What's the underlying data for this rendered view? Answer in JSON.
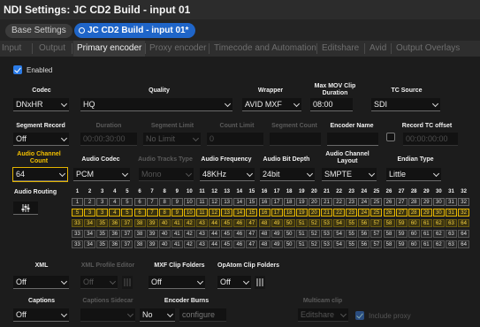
{
  "window": {
    "title": "NDI Settings: JC CD2 Build - input 01"
  },
  "settings_bar": {
    "base_label": "Base Settings",
    "active_label": "JC CD2 Build - input 01*"
  },
  "tabs": [
    "Input",
    "Output",
    "Primary encoder",
    "Proxy encoder",
    "Timecode and Automation",
    "Editshare",
    "Avid",
    "Output Overlays"
  ],
  "active_tab": "Primary encoder",
  "enabled": {
    "label": "Enabled",
    "checked": true
  },
  "row1": {
    "codec": {
      "label": "Codec",
      "value": "DNxHR"
    },
    "quality": {
      "label": "Quality",
      "value": "HQ"
    },
    "wrapper": {
      "label": "Wrapper",
      "value": "AVID MXF"
    },
    "max_mov": {
      "label_line1": "Max MOV Clip",
      "label_line2": "Duration",
      "value": "08:00"
    },
    "tc_source": {
      "label": "TC Source",
      "value": "SDI"
    }
  },
  "row2": {
    "segment_record": {
      "label": "Segment Record",
      "value": "Off"
    },
    "duration": {
      "label": "Duration",
      "value": "00:00:30:00"
    },
    "segment_limit": {
      "label": "Segment Limit",
      "value": "No Limit"
    },
    "count_limit": {
      "label": "Count Limit",
      "value": "0"
    },
    "segment_count": {
      "label": "Segment Count",
      "value": ""
    },
    "encoder_name": {
      "label": "Encoder Name",
      "value": ""
    },
    "record_tc_offset": {
      "label": "Record TC offset",
      "value": "00:00:00:00",
      "checked": false
    }
  },
  "row3": {
    "audio_channel_count": {
      "label_line1": "Audio Channel",
      "label_line2": "Count",
      "value": "64"
    },
    "audio_codec": {
      "label": "Audio Codec",
      "value": "PCM"
    },
    "audio_tracks_type": {
      "label": "Audio Tracks Type",
      "value": "Mono"
    },
    "audio_frequency": {
      "label": "Audio Frequency",
      "value": "48KHz"
    },
    "audio_bit_depth": {
      "label": "Audio Bit Depth",
      "value": "24bit"
    },
    "audio_channel_layout": {
      "label_line1": "Audio Channel",
      "label_line2": "Layout",
      "value": "SMPTE"
    },
    "endian_type": {
      "label": "Endian Type",
      "value": "Little"
    }
  },
  "routing": {
    "label": "Audio Routing",
    "header": [
      "1",
      "2",
      "3",
      "4",
      "5",
      "6",
      "7",
      "8",
      "9",
      "10",
      "11",
      "12",
      "13",
      "14",
      "15",
      "16",
      "17",
      "18",
      "19",
      "20",
      "21",
      "22",
      "23",
      "24",
      "25",
      "26",
      "27",
      "28",
      "29",
      "30",
      "31",
      "32"
    ],
    "rows": [
      [
        "1",
        "2",
        "3",
        "4",
        "5",
        "6",
        "7",
        "8",
        "9",
        "10",
        "11",
        "12",
        "13",
        "14",
        "15",
        "16",
        "17",
        "18",
        "19",
        "20",
        "21",
        "22",
        "23",
        "24",
        "25",
        "26",
        "27",
        "28",
        "29",
        "30",
        "31",
        "32"
      ],
      [
        "5",
        "3",
        "3",
        "4",
        "5",
        "6",
        "7",
        "8",
        "9",
        "10",
        "11",
        "12",
        "13",
        "14",
        "15",
        "16",
        "17",
        "18",
        "19",
        "20",
        "21",
        "22",
        "23",
        "24",
        "25",
        "26",
        "27",
        "28",
        "29",
        "30",
        "31",
        "32"
      ],
      [
        "33",
        "34",
        "35",
        "36",
        "37",
        "38",
        "39",
        "40",
        "41",
        "42",
        "43",
        "44",
        "45",
        "46",
        "47",
        "48",
        "49",
        "50",
        "51",
        "52",
        "53",
        "54",
        "55",
        "56",
        "57",
        "58",
        "59",
        "60",
        "61",
        "62",
        "63",
        "64"
      ],
      [
        "33",
        "34",
        "35",
        "36",
        "37",
        "38",
        "39",
        "40",
        "41",
        "42",
        "43",
        "44",
        "45",
        "46",
        "47",
        "48",
        "49",
        "50",
        "51",
        "52",
        "53",
        "54",
        "55",
        "56",
        "57",
        "58",
        "59",
        "60",
        "61",
        "62",
        "63",
        "64"
      ],
      [
        "33",
        "34",
        "35",
        "36",
        "37",
        "38",
        "39",
        "40",
        "41",
        "42",
        "43",
        "44",
        "45",
        "46",
        "47",
        "48",
        "49",
        "50",
        "51",
        "52",
        "53",
        "54",
        "55",
        "56",
        "57",
        "58",
        "59",
        "60",
        "61",
        "62",
        "63",
        "64"
      ]
    ]
  },
  "row4": {
    "xml": {
      "label": "XML",
      "value": "Off"
    },
    "xml_profile_editor": {
      "label": "XML Profile Editor",
      "value": "Off"
    },
    "mxf_clip_folders": {
      "label": "MXF Clip Folders",
      "value": "Off"
    },
    "opatom_clip_folders": {
      "label": "OpAtom Clip Folders",
      "value": "Off"
    }
  },
  "row5": {
    "captions": {
      "label": "Captions",
      "value": "Off"
    },
    "captions_sidecar": {
      "label": "Captions Sidecar",
      "value": ""
    },
    "encoder_burns": {
      "label": "Encoder Burns",
      "value": "No",
      "button": "configure"
    },
    "multicam_clip": {
      "label": "Multicam clip",
      "value": "Editshare"
    },
    "include_proxy": {
      "label": "Include proxy",
      "checked": true
    }
  },
  "colors": {
    "accent": "#1f65c8",
    "highlight": "#e4b400",
    "background": "#1c1c1c"
  },
  "icons": {
    "routing": "sliders-icon",
    "profile_editor": "sliders-icon"
  }
}
